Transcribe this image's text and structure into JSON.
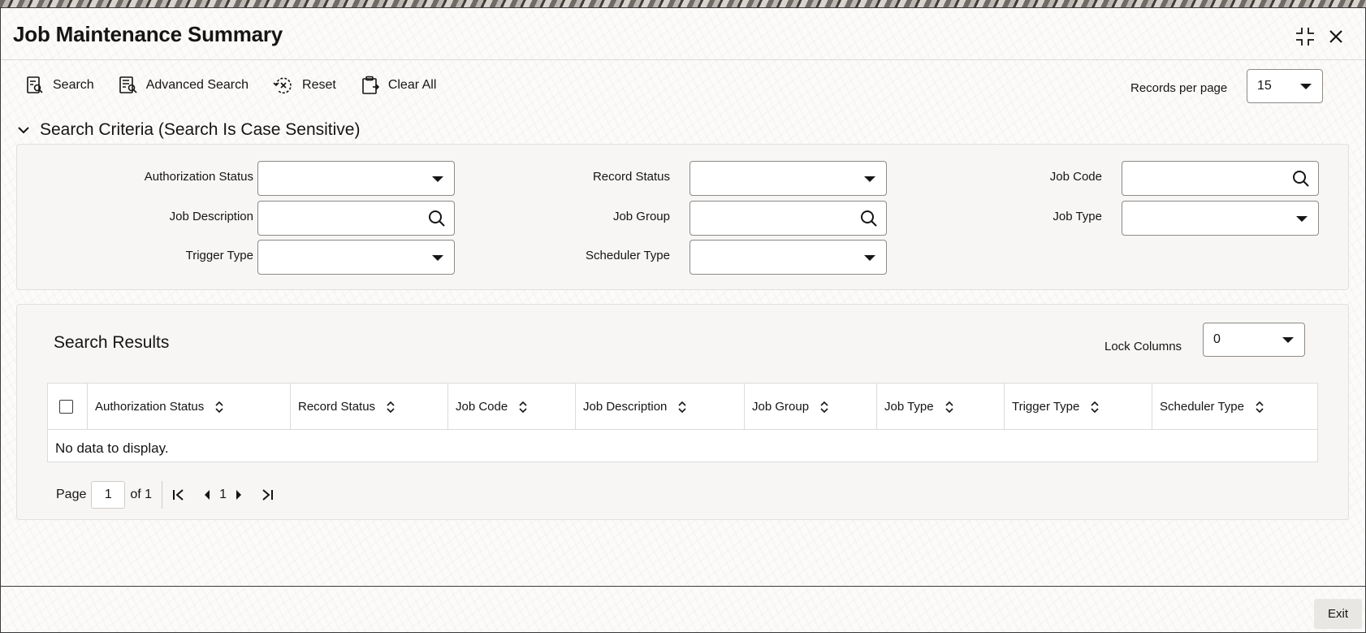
{
  "window": {
    "title": "Job Maintenance Summary",
    "controls": [
      "maximize-icon",
      "close-icon"
    ]
  },
  "toolbar": {
    "search_label": "Search",
    "advanced_search_label": "Advanced Search",
    "reset_label": "Reset",
    "clear_all_label": "Clear All"
  },
  "records_per_page": {
    "label": "Records per page",
    "value": "15"
  },
  "search_criteria": {
    "header": "Search Criteria (Search Is Case Sensitive)",
    "fields": {
      "authorization_status": {
        "label": "Authorization Status",
        "value": ""
      },
      "record_status": {
        "label": "Record Status",
        "value": ""
      },
      "job_code": {
        "label": "Job Code",
        "value": ""
      },
      "job_description": {
        "label": "Job Description",
        "value": ""
      },
      "job_group": {
        "label": "Job Group",
        "value": ""
      },
      "job_type": {
        "label": "Job Type",
        "value": ""
      },
      "trigger_type": {
        "label": "Trigger Type",
        "value": ""
      },
      "scheduler_type": {
        "label": "Scheduler Type",
        "value": ""
      }
    }
  },
  "results": {
    "title": "Search Results",
    "lock_columns": {
      "label": "Lock Columns",
      "value": "0"
    },
    "columns": [
      "Authorization Status",
      "Record Status",
      "Job Code",
      "Job Description",
      "Job Group",
      "Job Type",
      "Trigger Type",
      "Scheduler Type"
    ],
    "empty_message": "No data to display."
  },
  "pagination": {
    "page_label": "Page",
    "current_page": "1",
    "of_label": "of 1",
    "page_number": "1"
  },
  "footer": {
    "exit_label": "Exit"
  },
  "colors": {
    "accent_text": "#161513",
    "border": "#8d8a86",
    "panel_bg": "#f7f6f5",
    "exit_bg": "#e9e7e4"
  }
}
